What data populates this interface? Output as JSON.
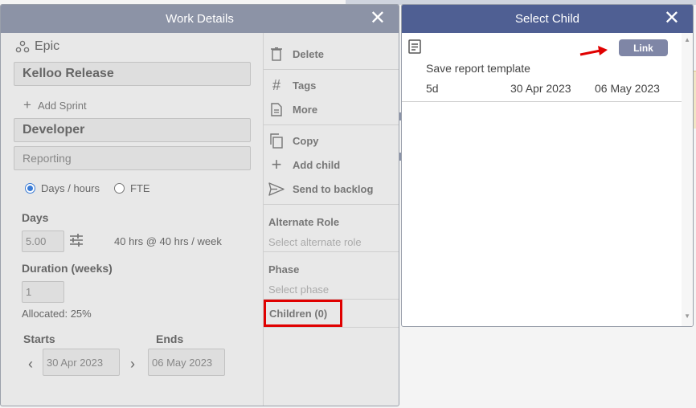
{
  "work_details": {
    "title": "Work Details",
    "close": "✕",
    "type_label": "Epic",
    "name_value": "Kelloo Release",
    "add_sprint": "Add Sprint",
    "role_value": "Developer",
    "skill_value": "Reporting",
    "mode_days": "Days / hours",
    "mode_fte": "FTE",
    "days_label": "Days",
    "days_value": "5.00",
    "hours_summary": "40 hrs @ 40 hrs / week",
    "duration_label": "Duration (weeks)",
    "duration_value": "1",
    "allocated": "Allocated: 25%",
    "starts_label": "Starts",
    "ends_label": "Ends",
    "start_date": "30 Apr 2023",
    "end_date": "06 May 2023",
    "prev": "‹",
    "next": "›",
    "actions": {
      "delete": "Delete",
      "tags": "Tags",
      "more": "More",
      "copy": "Copy",
      "add_child": "Add child",
      "send_to_backlog": "Send to backlog"
    },
    "alternate_role_title": "Alternate Role",
    "alternate_role_placeholder": "Select alternate role",
    "phase_title": "Phase",
    "phase_placeholder": "Select phase",
    "children_label": "Children (0)"
  },
  "select_child": {
    "title": "Select Child",
    "close": "✕",
    "link_button": "Link",
    "items": [
      {
        "name": "Save report template",
        "duration": "5d",
        "start": "30 Apr 2023",
        "end": "06 May 2023"
      }
    ]
  },
  "colors": {
    "work_details_header": "#8c93a6",
    "select_child_header": "#4f5f93",
    "highlight": "#e00000"
  }
}
